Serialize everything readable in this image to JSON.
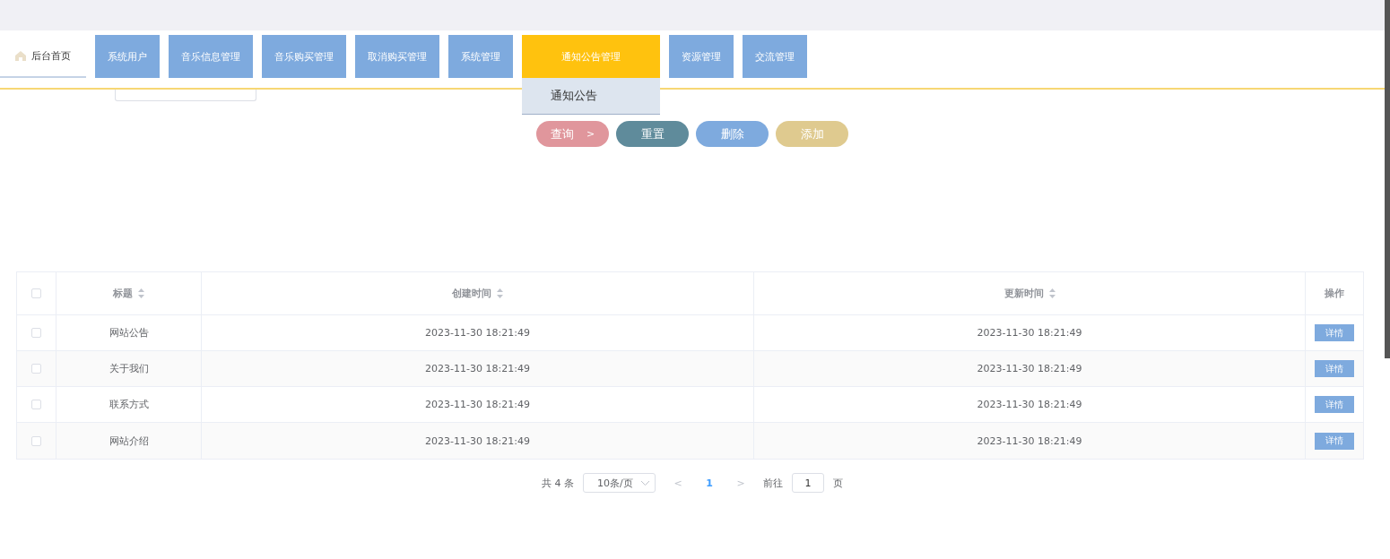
{
  "nav": {
    "home": {
      "label": "后台首页",
      "selected": true
    },
    "items": [
      {
        "label": "系统用户",
        "selected": false
      },
      {
        "label": "音乐信息管理",
        "selected": false
      },
      {
        "label": "音乐购买管理",
        "selected": false
      },
      {
        "label": "取消购买管理",
        "selected": false
      },
      {
        "label": "系统管理",
        "selected": false
      },
      {
        "label": "通知公告管理",
        "selected": true,
        "submenu": [
          "通知公告"
        ]
      },
      {
        "label": "资源管理",
        "selected": false
      },
      {
        "label": "交流管理",
        "selected": false
      }
    ]
  },
  "search": {
    "buttons": [
      {
        "label": "查询",
        "kind": "query",
        "arrow": ">"
      },
      {
        "label": "重置",
        "kind": "reset"
      },
      {
        "label": "删除",
        "kind": "delete"
      },
      {
        "label": "添加",
        "kind": "add"
      }
    ]
  },
  "table": {
    "all_checked": false,
    "columns": [
      {
        "label": "标题",
        "sortable": true
      },
      {
        "label": "创建时间",
        "sortable": true
      },
      {
        "label": "更新时间",
        "sortable": true
      },
      {
        "label": "操作",
        "sortable": false
      }
    ],
    "rows": [
      {
        "checked": false,
        "cells": [
          "网站公告",
          "2023-11-30 18:21:49",
          "2023-11-30 18:21:49"
        ],
        "action": "详情"
      },
      {
        "checked": false,
        "cells": [
          "关于我们",
          "2023-11-30 18:21:49",
          "2023-11-30 18:21:49"
        ],
        "action": "详情"
      },
      {
        "checked": false,
        "cells": [
          "联系方式",
          "2023-11-30 18:21:49",
          "2023-11-30 18:21:49"
        ],
        "action": "详情"
      },
      {
        "checked": false,
        "cells": [
          "网站介绍",
          "2023-11-30 18:21:49",
          "2023-11-30 18:21:49"
        ],
        "action": "详情"
      }
    ]
  },
  "pagination": {
    "total": "共 4 条",
    "page_size": "10条/页",
    "prev": "<",
    "pages": [
      {
        "label": "1",
        "selected": true
      }
    ],
    "next": ">",
    "goto_label": "前往",
    "goto_value": "1",
    "goto_suffix": "页"
  }
}
